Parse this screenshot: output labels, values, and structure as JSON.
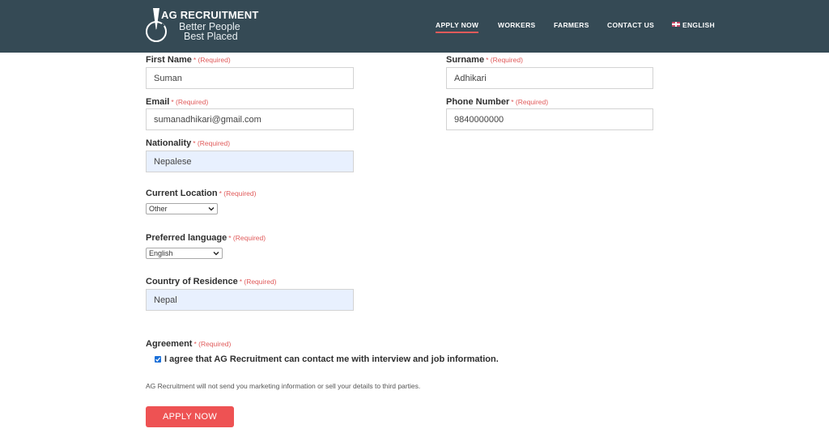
{
  "header": {
    "logo_title": "AG RECRUITMENT",
    "logo_tagline_1": "Better People",
    "logo_tagline_2": "Best Placed",
    "nav": [
      "APPLY NOW",
      "WORKERS",
      "FARMERS",
      "CONTACT US",
      "ENGLISH"
    ],
    "active_nav": "APPLY NOW"
  },
  "form": {
    "required_text": "* (Required)",
    "first_name": {
      "label": "First Name",
      "value": "Suman"
    },
    "surname": {
      "label": "Surname",
      "value": "Adhikari"
    },
    "email": {
      "label": "Email",
      "value": "sumanadhikari@gmail.com"
    },
    "phone": {
      "label": "Phone Number",
      "value": "9840000000"
    },
    "nationality": {
      "label": "Nationality",
      "value": "Nepalese"
    },
    "current_location": {
      "label": "Current Location",
      "value": "Other"
    },
    "preferred_language": {
      "label": "Preferred language",
      "value": "English"
    },
    "country_of_residence": {
      "label": "Country of Residence",
      "value": "Nepal"
    },
    "agreement": {
      "label": "Agreement",
      "checked": true,
      "text": "I agree that AG Recruitment can contact me with interview and job information."
    },
    "note": "AG Recruitment will not send you marketing information or sell your details to third parties.",
    "submit_label": "APPLY NOW"
  },
  "colors": {
    "header_bg": "#354a55",
    "accent": "#ee5253",
    "autofill_bg": "#e8f0fe",
    "checkbox": "#1a6fd8"
  }
}
